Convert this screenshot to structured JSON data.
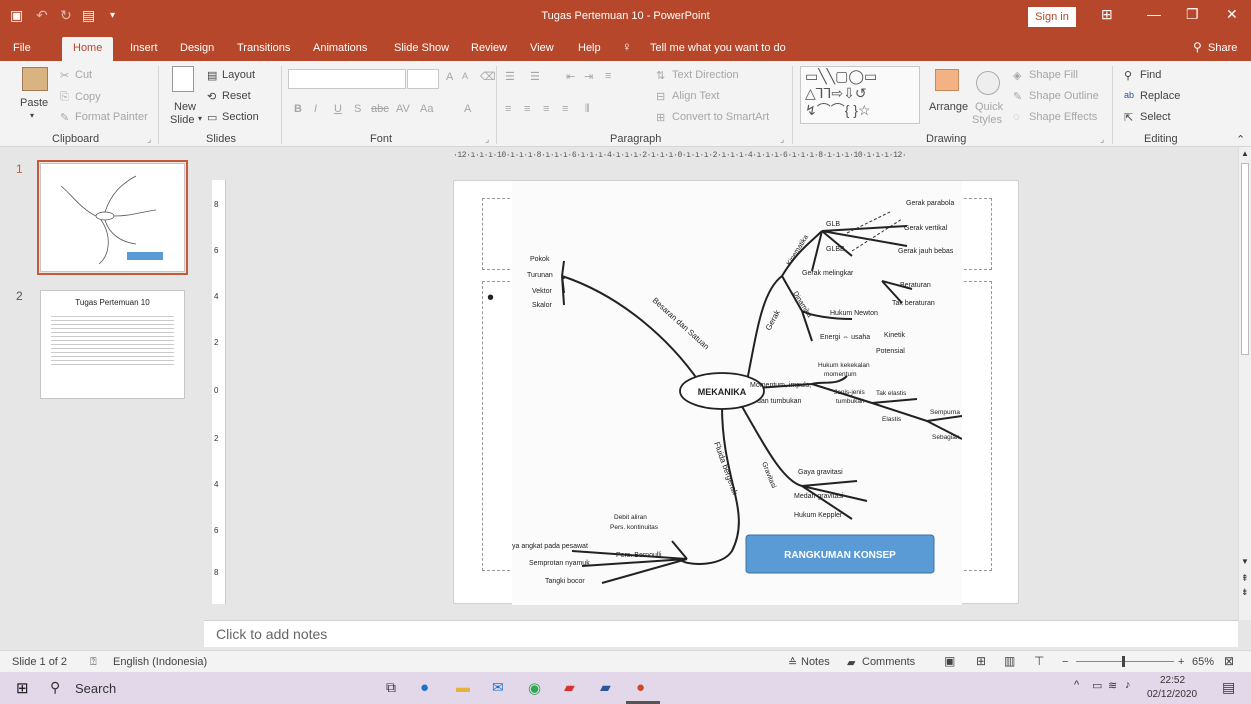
{
  "window": {
    "title": "Tugas Pertemuan 10  -  PowerPoint",
    "sign_in": "Sign in"
  },
  "tabs": [
    {
      "label": "File"
    },
    {
      "label": "Home",
      "active": true
    },
    {
      "label": "Insert"
    },
    {
      "label": "Design"
    },
    {
      "label": "Transitions"
    },
    {
      "label": "Animations"
    },
    {
      "label": "Slide Show"
    },
    {
      "label": "Review"
    },
    {
      "label": "View"
    },
    {
      "label": "Help"
    }
  ],
  "tell_me": "Tell me what you want to do",
  "share": "Share",
  "ribbon": {
    "clipboard": {
      "paste": "Paste",
      "cut": "Cut",
      "copy": "Copy",
      "format_painter": "Format Painter",
      "group": "Clipboard"
    },
    "slides": {
      "new_slide": "New",
      "new_slide2": "Slide",
      "layout": "Layout",
      "reset": "Reset",
      "section": "Section",
      "group": "Slides"
    },
    "font": {
      "bold": "B",
      "italic": "I",
      "underline": "U",
      "shadow": "S",
      "strike": "abc",
      "spacing": "AV",
      "case": "Aa",
      "color": "A",
      "grow": "A",
      "shrink": "A",
      "group": "Font"
    },
    "paragraph": {
      "text_direction": "Text Direction",
      "align_text": "Align Text",
      "convert_smartart": "Convert to SmartArt",
      "group": "Paragraph"
    },
    "drawing": {
      "arrange": "Arrange",
      "quick_styles": "Quick",
      "quick_styles2": "Styles",
      "shape_fill": "Shape Fill",
      "shape_outline": "Shape Outline",
      "shape_effects": "Shape Effects",
      "group": "Drawing"
    },
    "editing": {
      "find": "Find",
      "replace": "Replace",
      "select": "Select",
      "group": "Editing"
    }
  },
  "thumbnails": [
    {
      "number": "1",
      "caption": "RANGKUMAN KONSEP"
    },
    {
      "number": "2",
      "title": "Tugas Pertemuan 10"
    }
  ],
  "ruler": "·12·ı·ı·ı·10·ı·ı·ı·8·ı·ı·ı·6·ı·ı·ı·4·ı·ı·ı·2·ı·ı·ı·0·ı·ı·ı·2·ı·ı·ı·4·ı·ı·ı·6·ı·ı·ı·8·ı·ı·ı·10·ı·ı·ı·12·",
  "vruler": [
    "8",
    "6",
    "4",
    "2",
    "0",
    "2",
    "4",
    "6",
    "8"
  ],
  "mindmap": {
    "center": "MEKANIKA",
    "button": "RANGKUMAN KONSEP",
    "branches": {
      "besaran": "Besaran dan Satuan",
      "gerak": "Gerak",
      "kinematika": "Kinematika",
      "dinamika": "Dinamika",
      "momentum1": "Momentum, impuls,",
      "momentum2": "dan tumbukan",
      "gravitasi": "Gravitasi",
      "fluida": "Fluida bergerak"
    },
    "leaves": {
      "pokok": "Pokok",
      "turunan": "Turunan",
      "vektor": "Vektor",
      "skalor": "Skalor",
      "glb": "GLB",
      "glbb": "GLBB",
      "gerak_melingkar": "Gerak melingkar",
      "gerak_parabola": "Gerak parabola",
      "gerak_vertikal": "Gerak vertikal",
      "gerak_jauh_bebas": "Gerak jauh bebas",
      "beraturan": "Beraturan",
      "tak_beraturan": "Tak beraturan",
      "hukum_newton": "Hukum Newton",
      "energi_usaha": "Energi ⇔ usaha",
      "kinetik": "Kinetik",
      "potensial": "Potensial",
      "hukum_kekekalan1": "Hukum kekekalan",
      "hukum_kekekalan2": "momentum",
      "jenis1": "Jenis-jenis",
      "jenis2": "tumbukan",
      "tak_elastis": "Tak elastis",
      "elastis": "Elastis",
      "sempurna": "Sempurna",
      "sebagian": "Sebagian",
      "gaya_gravitasi": "Gaya gravitasi",
      "medan_gravitasi": "Medan gravitasi",
      "hukum_keppler": "Hukum Keppler",
      "debit1": "Debit aliran",
      "debit2": "Pers. kontinuitas",
      "gaya_angkat": "ya angkat pada pesawat",
      "pers_bernoulli": "Pers. Bernoulli",
      "semprotan": "Semprotan nyamuk",
      "tangki": "Tangki bocor"
    }
  },
  "notes_placeholder": "Click to add notes",
  "status": {
    "slide": "Slide 1 of 2",
    "language": "English (Indonesia)",
    "notes": "Notes",
    "comments": "Comments",
    "zoom": "65%"
  },
  "taskbar": {
    "search": "Search",
    "time": "22:52",
    "date": "02/12/2020"
  },
  "colors": {
    "accent": "#b7472a",
    "button_blue": "#5b9bd5",
    "taskbar": "#e3d7ea"
  }
}
